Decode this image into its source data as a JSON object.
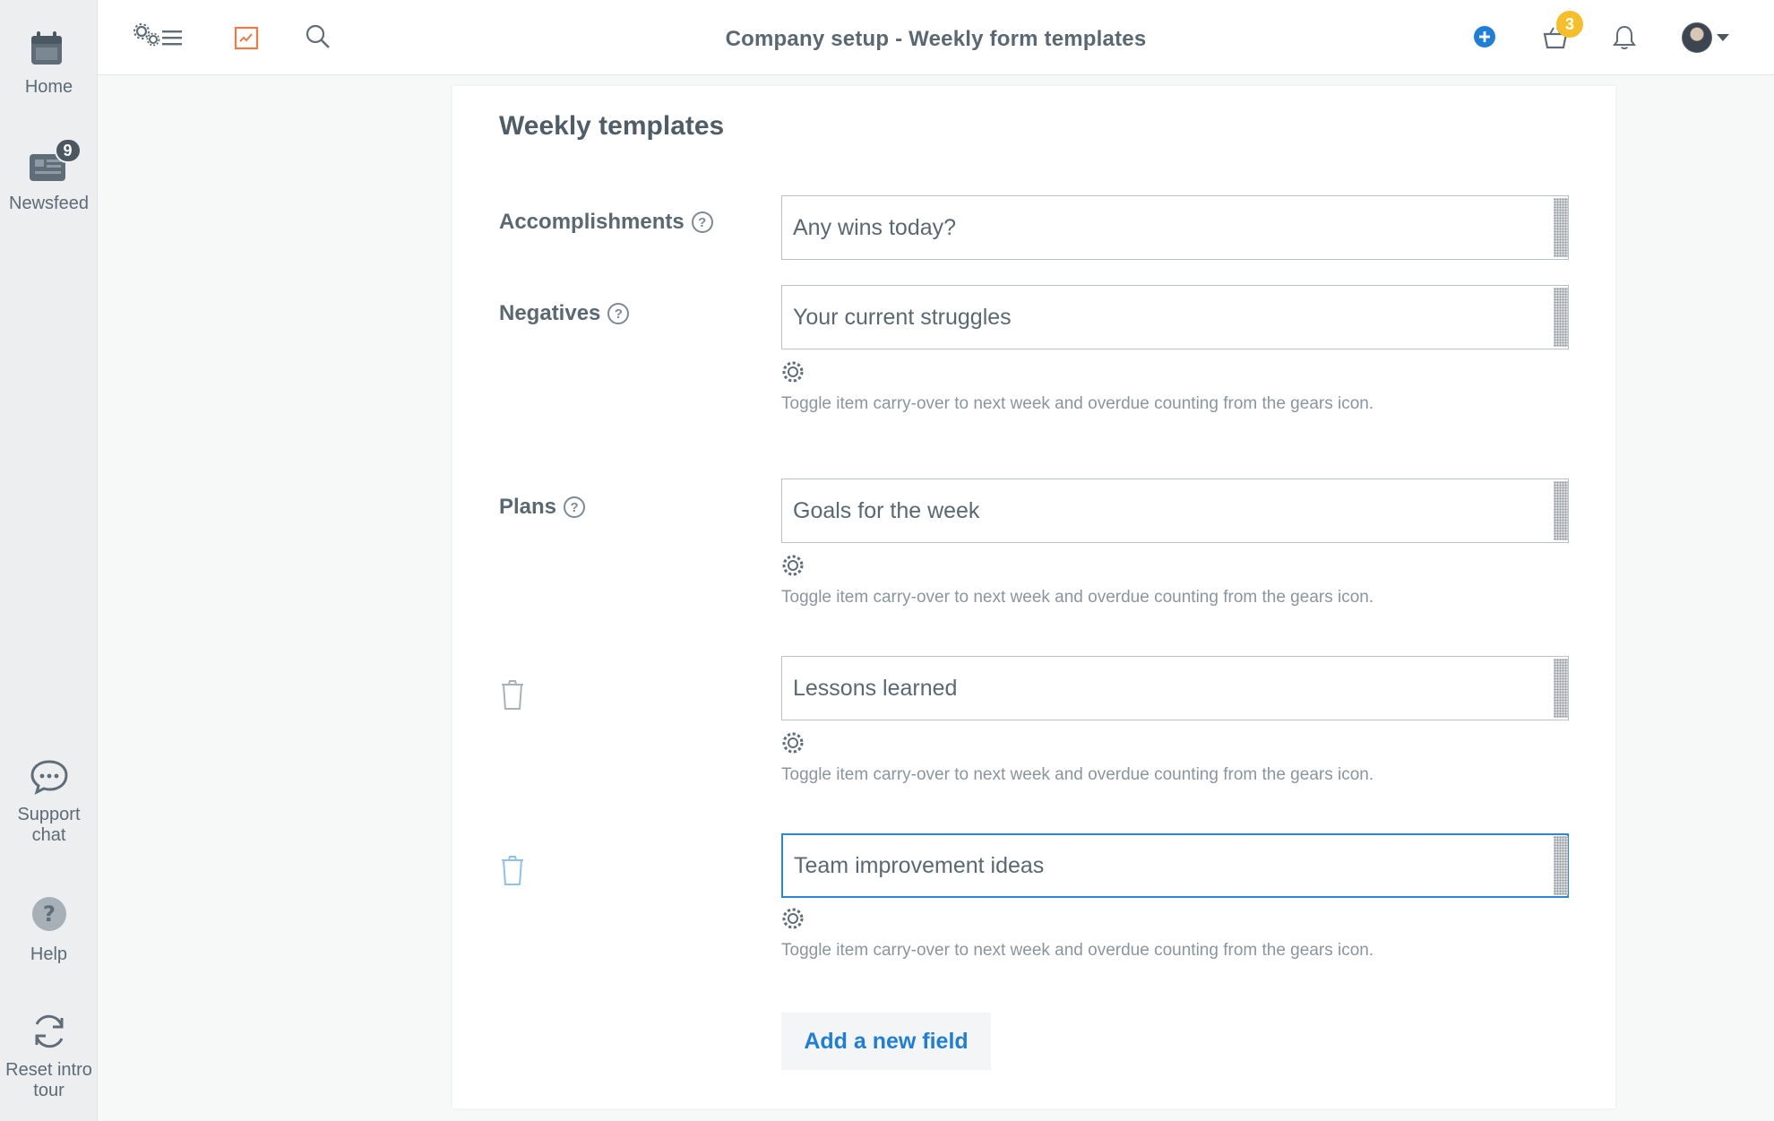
{
  "sidebar": {
    "home_label": "Home",
    "newsfeed_label": "Newsfeed",
    "newsfeed_badge": "9",
    "support_label": "Support chat",
    "help_label": "Help",
    "reset_label": "Reset intro tour"
  },
  "topbar": {
    "title": "Company setup - Weekly form templates",
    "cart_badge": "3"
  },
  "card": {
    "title": "Weekly templates",
    "hint_text": "Toggle item carry-over to next week and overdue counting from the gears icon.",
    "add_label": "Add a new field",
    "fields": [
      {
        "label": "Accomplishments",
        "value": "Any wins today?"
      },
      {
        "label": "Negatives",
        "value": "Your current struggles"
      },
      {
        "label": "Plans",
        "value": "Goals for the week"
      },
      {
        "label": "",
        "value": "Lessons learned"
      },
      {
        "label": "",
        "value": "Team improvement ideas"
      }
    ]
  },
  "colors": {
    "accent": "#1f7fd8",
    "badge_yellow": "#f4bf2a",
    "focus_border": "#2b87d8",
    "trash_active": "#8fc0ef"
  }
}
